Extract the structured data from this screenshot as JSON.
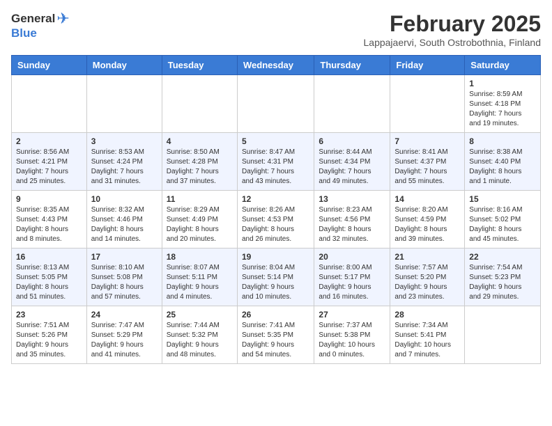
{
  "header": {
    "logo_general": "General",
    "logo_blue": "Blue",
    "month_year": "February 2025",
    "location": "Lappajaervi, South Ostrobothnia, Finland"
  },
  "weekdays": [
    "Sunday",
    "Monday",
    "Tuesday",
    "Wednesday",
    "Thursday",
    "Friday",
    "Saturday"
  ],
  "weeks": [
    [
      {
        "day": "",
        "info": ""
      },
      {
        "day": "",
        "info": ""
      },
      {
        "day": "",
        "info": ""
      },
      {
        "day": "",
        "info": ""
      },
      {
        "day": "",
        "info": ""
      },
      {
        "day": "",
        "info": ""
      },
      {
        "day": "1",
        "info": "Sunrise: 8:59 AM\nSunset: 4:18 PM\nDaylight: 7 hours\nand 19 minutes."
      }
    ],
    [
      {
        "day": "2",
        "info": "Sunrise: 8:56 AM\nSunset: 4:21 PM\nDaylight: 7 hours\nand 25 minutes."
      },
      {
        "day": "3",
        "info": "Sunrise: 8:53 AM\nSunset: 4:24 PM\nDaylight: 7 hours\nand 31 minutes."
      },
      {
        "day": "4",
        "info": "Sunrise: 8:50 AM\nSunset: 4:28 PM\nDaylight: 7 hours\nand 37 minutes."
      },
      {
        "day": "5",
        "info": "Sunrise: 8:47 AM\nSunset: 4:31 PM\nDaylight: 7 hours\nand 43 minutes."
      },
      {
        "day": "6",
        "info": "Sunrise: 8:44 AM\nSunset: 4:34 PM\nDaylight: 7 hours\nand 49 minutes."
      },
      {
        "day": "7",
        "info": "Sunrise: 8:41 AM\nSunset: 4:37 PM\nDaylight: 7 hours\nand 55 minutes."
      },
      {
        "day": "8",
        "info": "Sunrise: 8:38 AM\nSunset: 4:40 PM\nDaylight: 8 hours\nand 1 minute."
      }
    ],
    [
      {
        "day": "9",
        "info": "Sunrise: 8:35 AM\nSunset: 4:43 PM\nDaylight: 8 hours\nand 8 minutes."
      },
      {
        "day": "10",
        "info": "Sunrise: 8:32 AM\nSunset: 4:46 PM\nDaylight: 8 hours\nand 14 minutes."
      },
      {
        "day": "11",
        "info": "Sunrise: 8:29 AM\nSunset: 4:49 PM\nDaylight: 8 hours\nand 20 minutes."
      },
      {
        "day": "12",
        "info": "Sunrise: 8:26 AM\nSunset: 4:53 PM\nDaylight: 8 hours\nand 26 minutes."
      },
      {
        "day": "13",
        "info": "Sunrise: 8:23 AM\nSunset: 4:56 PM\nDaylight: 8 hours\nand 32 minutes."
      },
      {
        "day": "14",
        "info": "Sunrise: 8:20 AM\nSunset: 4:59 PM\nDaylight: 8 hours\nand 39 minutes."
      },
      {
        "day": "15",
        "info": "Sunrise: 8:16 AM\nSunset: 5:02 PM\nDaylight: 8 hours\nand 45 minutes."
      }
    ],
    [
      {
        "day": "16",
        "info": "Sunrise: 8:13 AM\nSunset: 5:05 PM\nDaylight: 8 hours\nand 51 minutes."
      },
      {
        "day": "17",
        "info": "Sunrise: 8:10 AM\nSunset: 5:08 PM\nDaylight: 8 hours\nand 57 minutes."
      },
      {
        "day": "18",
        "info": "Sunrise: 8:07 AM\nSunset: 5:11 PM\nDaylight: 9 hours\nand 4 minutes."
      },
      {
        "day": "19",
        "info": "Sunrise: 8:04 AM\nSunset: 5:14 PM\nDaylight: 9 hours\nand 10 minutes."
      },
      {
        "day": "20",
        "info": "Sunrise: 8:00 AM\nSunset: 5:17 PM\nDaylight: 9 hours\nand 16 minutes."
      },
      {
        "day": "21",
        "info": "Sunrise: 7:57 AM\nSunset: 5:20 PM\nDaylight: 9 hours\nand 23 minutes."
      },
      {
        "day": "22",
        "info": "Sunrise: 7:54 AM\nSunset: 5:23 PM\nDaylight: 9 hours\nand 29 minutes."
      }
    ],
    [
      {
        "day": "23",
        "info": "Sunrise: 7:51 AM\nSunset: 5:26 PM\nDaylight: 9 hours\nand 35 minutes."
      },
      {
        "day": "24",
        "info": "Sunrise: 7:47 AM\nSunset: 5:29 PM\nDaylight: 9 hours\nand 41 minutes."
      },
      {
        "day": "25",
        "info": "Sunrise: 7:44 AM\nSunset: 5:32 PM\nDaylight: 9 hours\nand 48 minutes."
      },
      {
        "day": "26",
        "info": "Sunrise: 7:41 AM\nSunset: 5:35 PM\nDaylight: 9 hours\nand 54 minutes."
      },
      {
        "day": "27",
        "info": "Sunrise: 7:37 AM\nSunset: 5:38 PM\nDaylight: 10 hours\nand 0 minutes."
      },
      {
        "day": "28",
        "info": "Sunrise: 7:34 AM\nSunset: 5:41 PM\nDaylight: 10 hours\nand 7 minutes."
      },
      {
        "day": "",
        "info": ""
      }
    ]
  ]
}
